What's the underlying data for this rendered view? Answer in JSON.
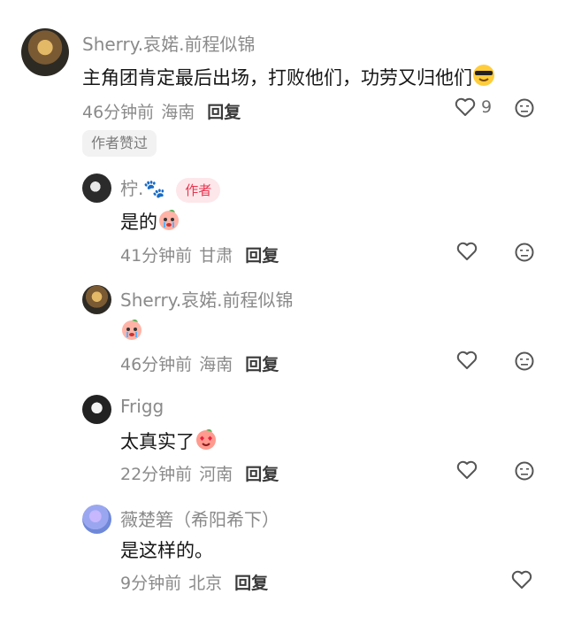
{
  "comments": [
    {
      "username": "Sherry.哀婼.前程似锦",
      "text": "主角团肯定最后出场，打败他们，功劳又归他们",
      "time": "46分钟前",
      "location": "海南",
      "reply_label": "回复",
      "likes": "9",
      "tag": "作者赞过"
    }
  ],
  "replies": [
    {
      "username": "柠.🐾",
      "badge": "作者",
      "text": "是的",
      "time": "41分钟前",
      "location": "甘肃",
      "reply_label": "回复"
    },
    {
      "username": "Sherry.哀婼.前程似锦",
      "text": "",
      "time": "46分钟前",
      "location": "海南",
      "reply_label": "回复"
    },
    {
      "username": "Frigg",
      "text": "太真实了",
      "time": "22分钟前",
      "location": "河南",
      "reply_label": "回复"
    },
    {
      "username": "薇楚箬（希阳希下）",
      "text": "是这样的。",
      "time": "9分钟前",
      "location": "北京",
      "reply_label": "回复"
    }
  ],
  "icons": {
    "like": "heart-outline-icon",
    "dislike": "neutral-face-icon",
    "cool_emoji": "sunglasses-face-emoji",
    "peach_cry_emoji": "crying-peach-emoji",
    "peach_love_emoji": "heart-eyes-peach-emoji"
  },
  "colors": {
    "username": "#8a8a8a",
    "text": "#161616",
    "author_badge_bg": "#fde7ea",
    "author_badge_text": "#e8344e"
  }
}
